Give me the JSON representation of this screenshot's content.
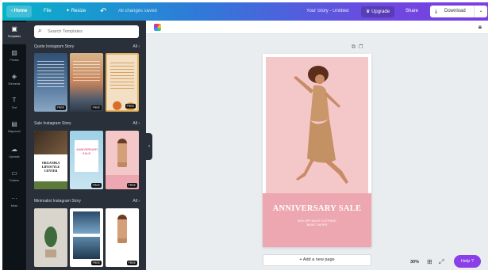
{
  "topbar": {
    "home_label": "Home",
    "file_label": "File",
    "resize_label": "Resize",
    "saved_status": "All changes saved",
    "doc_title": "Your Story - Untitled",
    "upgrade_label": "Upgrade",
    "share_label": "Share",
    "download_label": "Download"
  },
  "rail": {
    "items": [
      {
        "label": "Templates",
        "icon": "templates-icon"
      },
      {
        "label": "Photos",
        "icon": "photos-icon"
      },
      {
        "label": "Elements",
        "icon": "elements-icon"
      },
      {
        "label": "Text",
        "icon": "text-icon"
      },
      {
        "label": "Bkground",
        "icon": "background-icon"
      },
      {
        "label": "Uploads",
        "icon": "uploads-icon"
      },
      {
        "label": "Folders",
        "icon": "folders-icon"
      },
      {
        "label": "More",
        "icon": "more-icon"
      }
    ]
  },
  "panel": {
    "search_placeholder": "Search Templates",
    "sections": [
      {
        "title": "Quote Instagram Story",
        "all": "All"
      },
      {
        "title": "Sale Instagram Story",
        "all": "All"
      },
      {
        "title": "Minimalist Instagram Story",
        "all": "All"
      }
    ],
    "badge": "FREE",
    "thumb_texts": {
      "organika": "ORGANIKA LIFESTYLE CENTER",
      "anniversary": "ANNIVERSARY SALE"
    }
  },
  "canvas": {
    "sale_title": "ANNIVERSARY SALE",
    "sale_subtitle_1": "50% OFF BAGS CLOTHING",
    "sale_subtitle_2": "BASIC SHOPS",
    "add_page": "+ Add a new page",
    "zoom": "30%",
    "help": "Help ?"
  },
  "colors": {
    "gradient_start": "#08b3c9",
    "gradient_end": "#7d3de2",
    "panel_bg": "#293039",
    "rail_bg": "#0e1318",
    "sale_pink": "#eda7b0",
    "help_purple": "#8b3fe6"
  }
}
